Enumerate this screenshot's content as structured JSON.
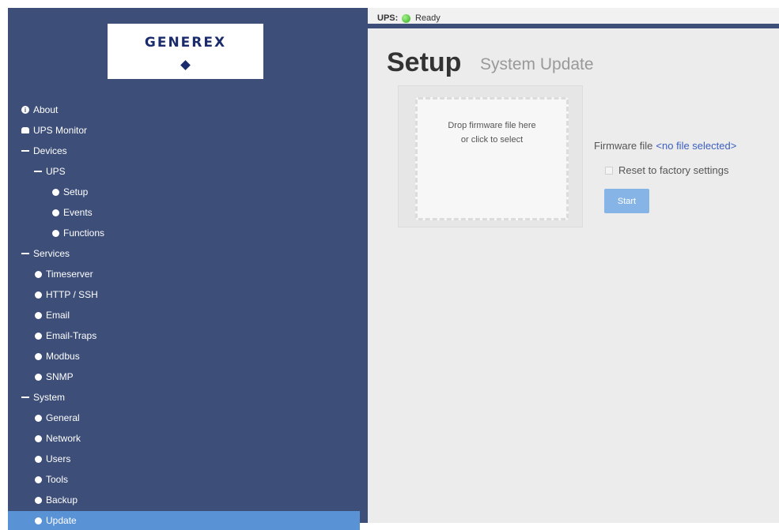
{
  "logo": {
    "text": "GENEREX"
  },
  "status": {
    "label": "UPS:",
    "text": "Ready"
  },
  "page": {
    "title": "Setup",
    "subtitle": "System Update"
  },
  "upload": {
    "line1": "Drop firmware file here",
    "line2": "or click to select"
  },
  "firmware": {
    "label": "Firmware file",
    "value": "<no file selected>"
  },
  "reset": {
    "label": "Reset to factory settings"
  },
  "start": {
    "label": "Start"
  },
  "colors": {
    "sidebar": "#3d4e78",
    "active_item": "#5a92d6",
    "status_ok": "#2fae1a",
    "button": "#86b4e6",
    "link": "#3b5fc0"
  },
  "nav": {
    "about": "About",
    "ups_monitor": "UPS Monitor",
    "devices": "Devices",
    "ups": "UPS",
    "setup": "Setup",
    "events": "Events",
    "functions": "Functions",
    "services": "Services",
    "timeserver": "Timeserver",
    "http_ssh": "HTTP / SSH",
    "email": "Email",
    "email_traps": "Email-Traps",
    "modbus": "Modbus",
    "snmp": "SNMP",
    "system": "System",
    "general": "General",
    "network": "Network",
    "users": "Users",
    "tools": "Tools",
    "backup": "Backup",
    "update": "Update"
  }
}
